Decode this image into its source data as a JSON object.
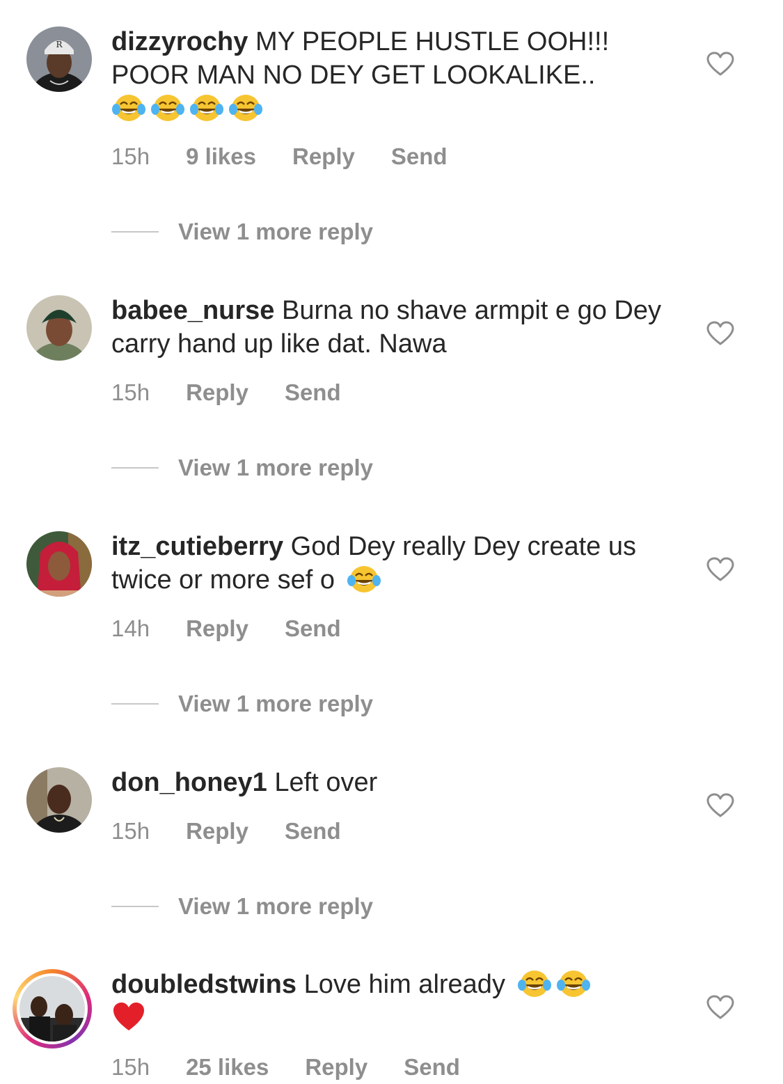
{
  "comments": [
    {
      "username": "dizzyrochy",
      "text_line1": "MY PEOPLE HUSTLE OOH!!!",
      "text_line2": "POOR MAN NO DEY GET LOOKALIKE..",
      "emoji_line": [
        "tears-of-joy-emoji",
        "tears-of-joy-emoji",
        "tears-of-joy-emoji",
        "tears-of-joy-emoji"
      ],
      "time": "15h",
      "likes": "9 likes",
      "reply_label": "Reply",
      "send_label": "Send",
      "view_replies": "View 1 more reply"
    },
    {
      "username": "babee_nurse",
      "text": "Burna no shave armpit e go Dey carry hand up like dat. Nawa",
      "time": "15h",
      "reply_label": "Reply",
      "send_label": "Send",
      "view_replies": "View 1 more reply"
    },
    {
      "username": "itz_cutieberry",
      "text": "God Dey really Dey create us twice or more sef o",
      "trailing_emoji": "tears-of-joy-emoji",
      "time": "14h",
      "reply_label": "Reply",
      "send_label": "Send",
      "view_replies": "View 1 more reply"
    },
    {
      "username": "don_honey1",
      "text": "Left over",
      "time": "15h",
      "reply_label": "Reply",
      "send_label": "Send",
      "view_replies": "View 1 more reply"
    },
    {
      "username": "doubledstwins",
      "text": "Love him already",
      "trailing_emojis": [
        "tears-of-joy-emoji",
        "tears-of-joy-emoji",
        "red-heart-emoji"
      ],
      "time": "15h",
      "likes": "25 likes",
      "reply_label": "Reply",
      "send_label": "Send"
    }
  ],
  "colors": {
    "text": "#262626",
    "secondary": "#8e8e8e",
    "story_ring": [
      "#f58529",
      "#dd2a7b",
      "#8134af",
      "#feda77"
    ]
  }
}
